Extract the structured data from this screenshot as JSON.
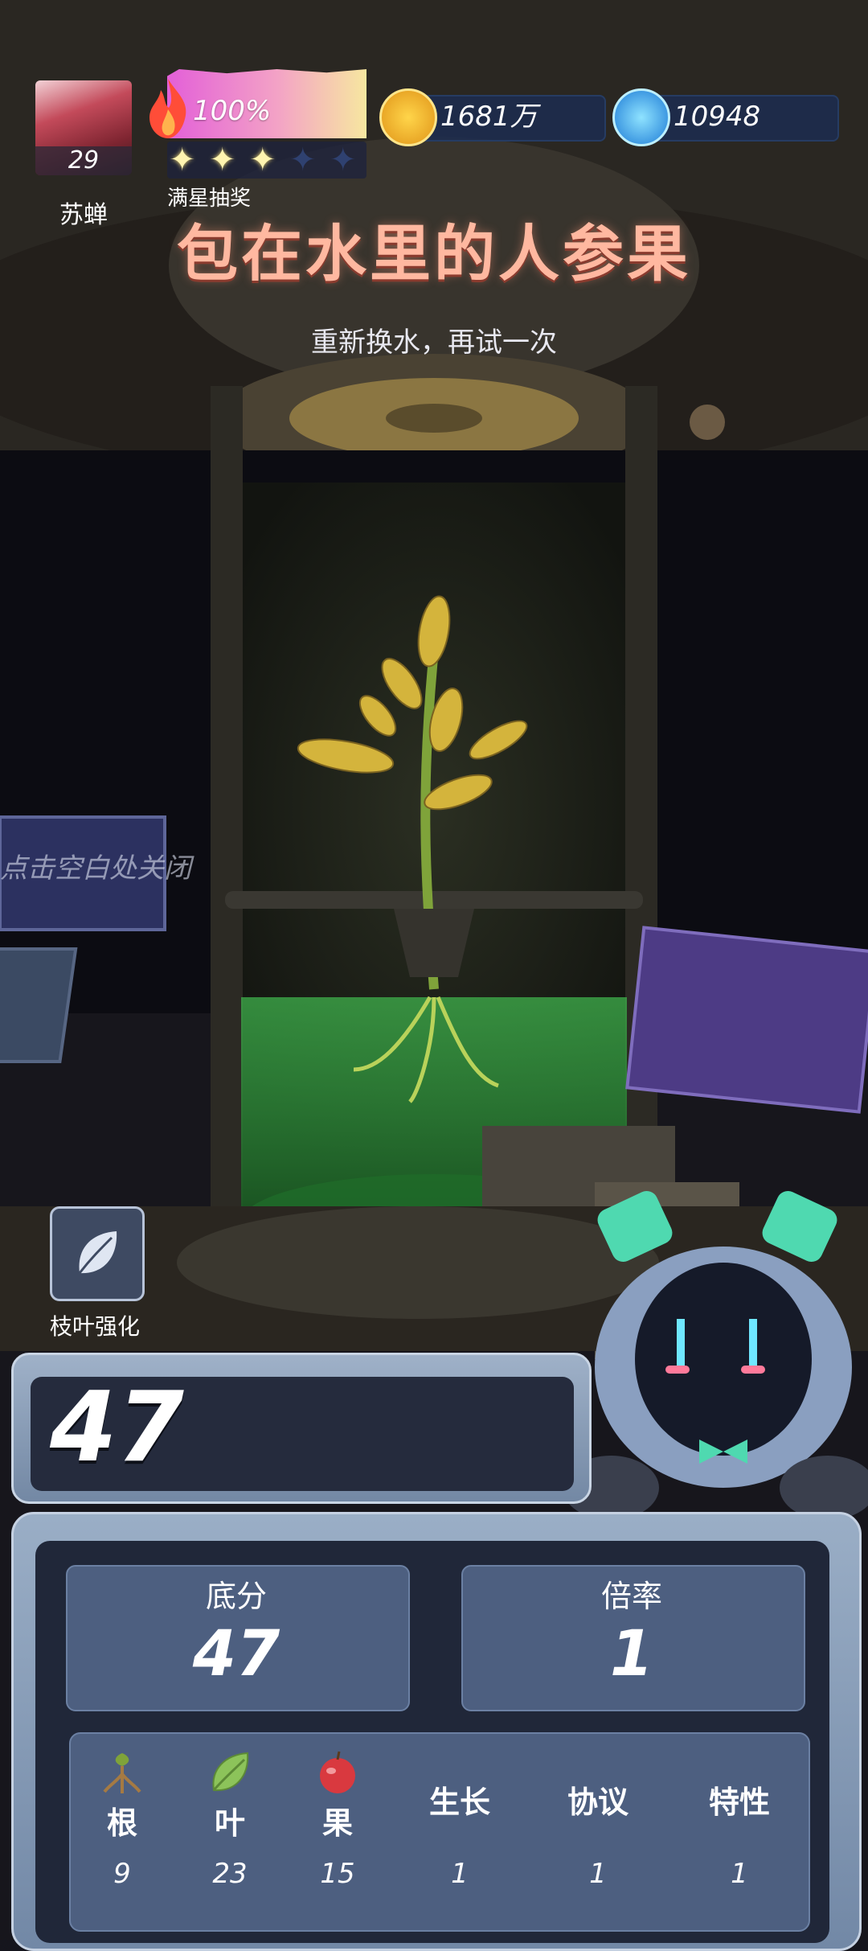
{
  "player": {
    "name": "苏蝉",
    "level": "29"
  },
  "energy": {
    "percent_label": "100%",
    "stars_total": 5,
    "stars_filled": 3,
    "star_reward_label": "满星抽奖"
  },
  "currency": {
    "coins": "1681万",
    "gems": "10948"
  },
  "title": "包在水里的人参果",
  "subtitle": "重新换水，再试一次",
  "close_hint": "点击空白处关闭",
  "skill": {
    "label": "枝叶强化",
    "icon": "leaf-icon"
  },
  "score": {
    "total": "47"
  },
  "stats": {
    "base_label": "底分",
    "base_value": "47",
    "multiplier_label": "倍率",
    "multiplier_value": "1"
  },
  "breakdown": [
    {
      "label": "根",
      "value": "9",
      "icon": "root-icon"
    },
    {
      "label": "叶",
      "value": "23",
      "icon": "leaf-icon"
    },
    {
      "label": "果",
      "value": "15",
      "icon": "apple-icon"
    },
    {
      "label": "生长",
      "value": "1"
    },
    {
      "label": "协议",
      "value": "1"
    },
    {
      "label": "特性",
      "value": "1"
    }
  ],
  "colors": {
    "title": "#ffb8a0",
    "panel": "#4d5f80",
    "panel_dark": "#202739",
    "liquid": "#2f9a3a",
    "leaf": "#d4b43c"
  }
}
